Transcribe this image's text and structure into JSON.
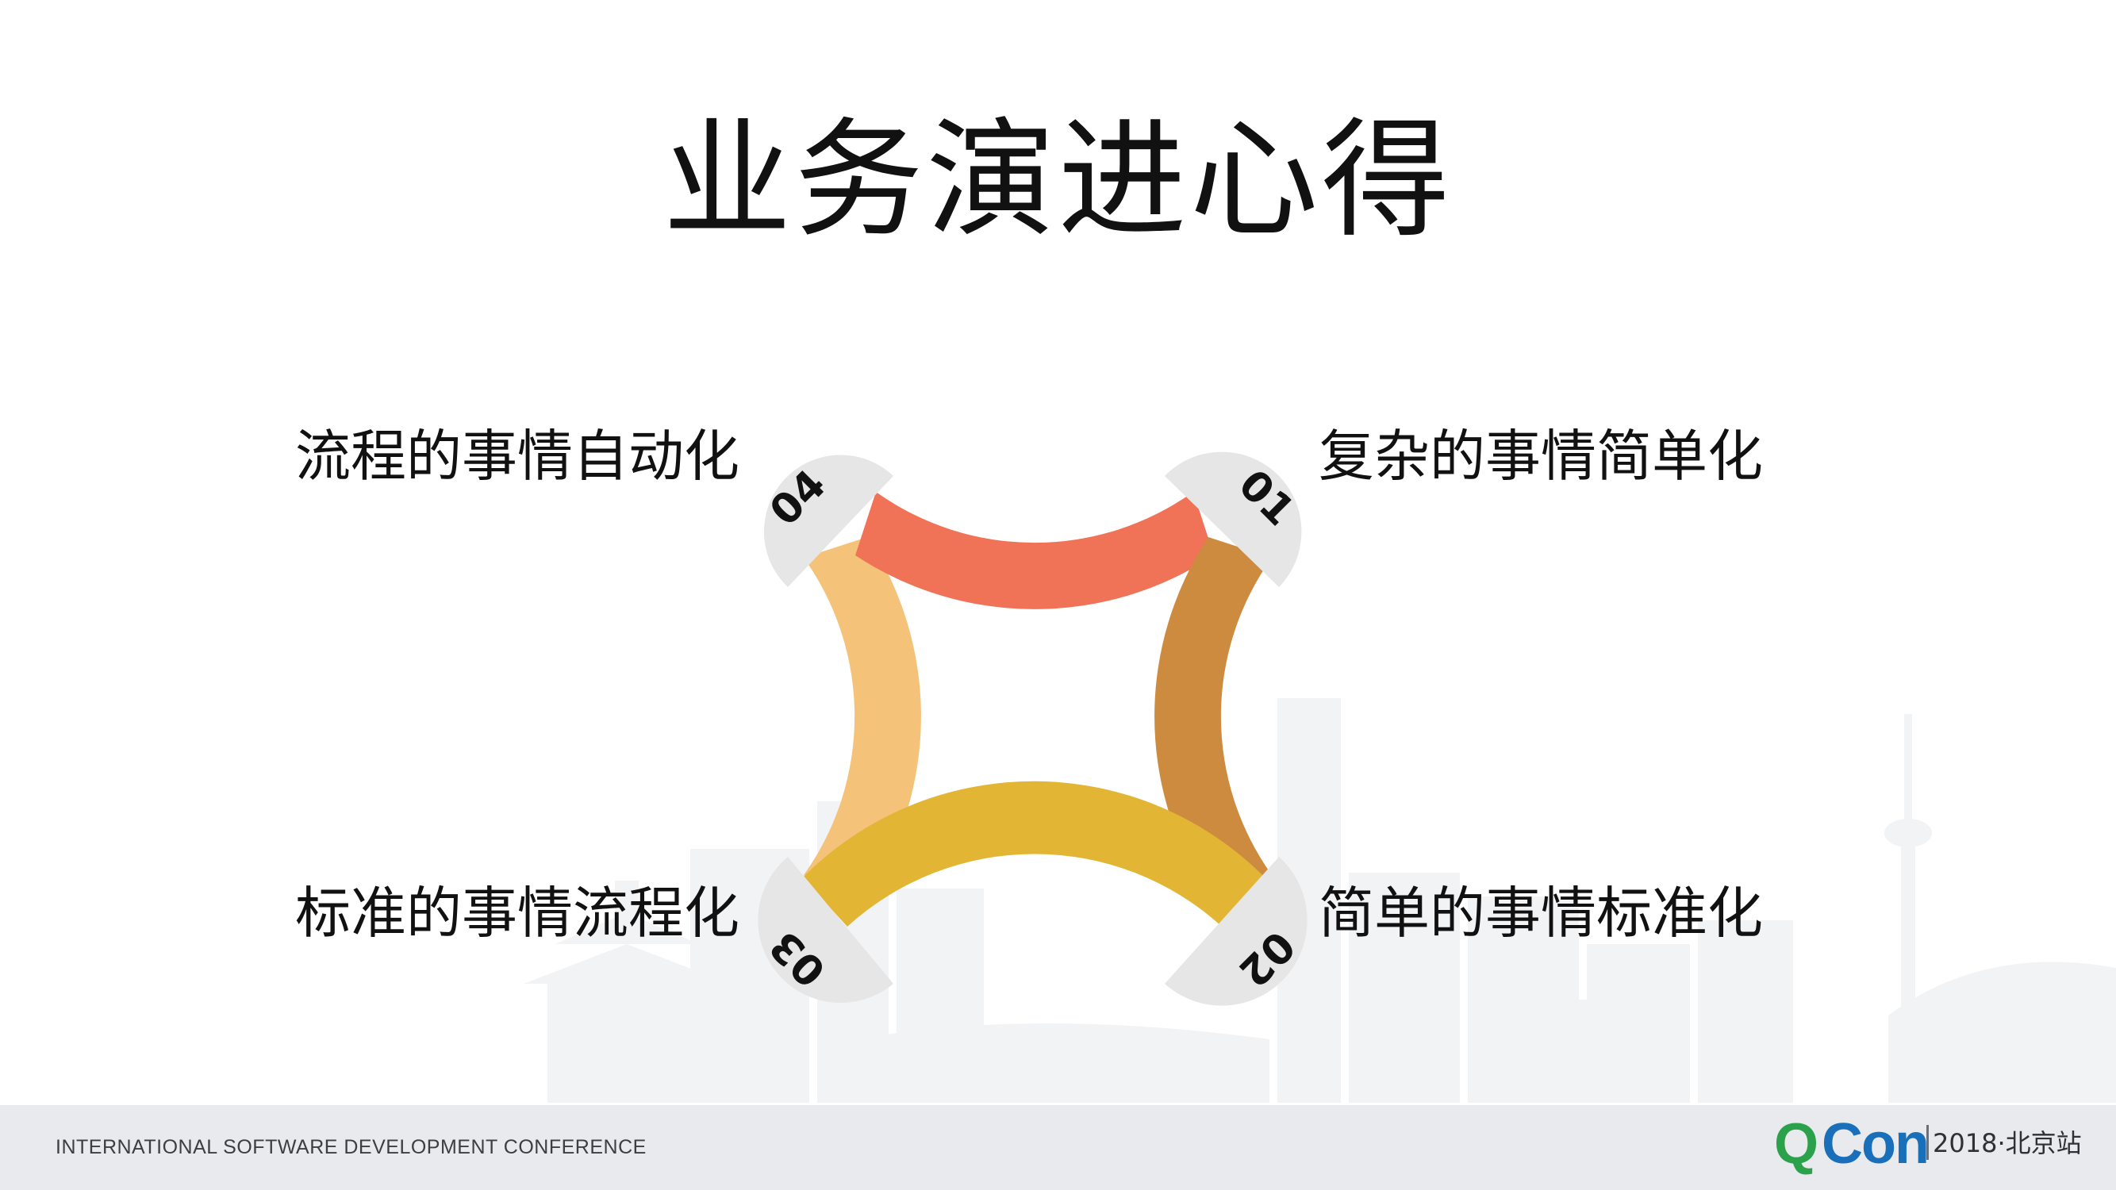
{
  "slide": {
    "title": "业务演进心得",
    "labels": {
      "top_left": "流程的事情自动化",
      "top_right": "复杂的事情简单化",
      "bottom_left": "标准的事情流程化",
      "bottom_right": "简单的事情标准化"
    },
    "numbers": {
      "n01": "01",
      "n02": "02",
      "n03": "03",
      "n04": "04"
    }
  },
  "colors": {
    "arc_top": "#f07358",
    "arc_right": "#cd8b3f",
    "arc_bottom": "#e2b535",
    "arc_left": "#f4c279",
    "badge": "#e6e6e6",
    "skyline": "#f2f3f5",
    "footer": "#e8eaed",
    "logo_q": "#2aa14a",
    "logo_con": "#1a6fba"
  },
  "footer": {
    "conference": "INTERNATIONAL SOFTWARE DEVELOPMENT CONFERENCE",
    "logo_q": "Q",
    "logo_con": "Con",
    "event": "2018·北京站"
  }
}
